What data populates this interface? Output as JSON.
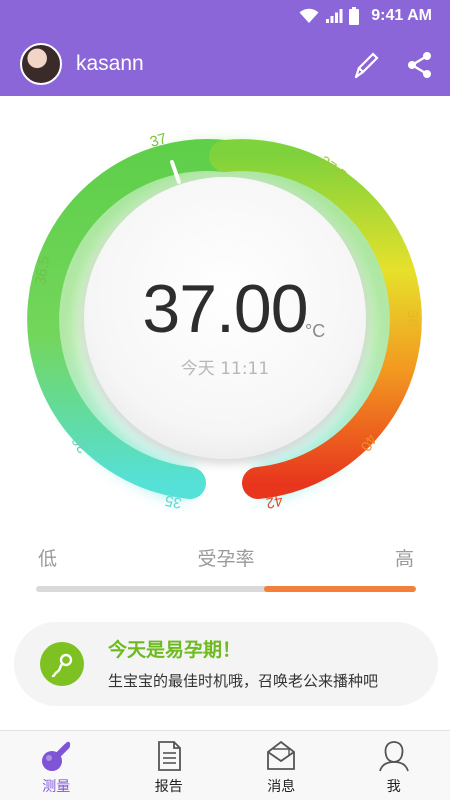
{
  "status_bar": {
    "time": "9:41 AM",
    "icons": [
      "wifi-icon",
      "signal-icon",
      "battery-icon"
    ]
  },
  "header": {
    "username": "kasann",
    "icons": [
      "avatar",
      "thermometer-icon",
      "share-icon"
    ]
  },
  "gauge": {
    "value": "37.00",
    "unit": "°C",
    "date": "今天 11:11",
    "ticks": [
      "35",
      "36",
      "36.5",
      "37",
      "37.5",
      "38",
      "40",
      "42"
    ]
  },
  "fertility": {
    "low": "低",
    "title": "受孕率",
    "high": "高",
    "level": 0.4
  },
  "tip": {
    "title": "今天是易孕期！",
    "text": "生宝宝的最佳时机哦，召唤老公来播种吧",
    "icon": "sperm-icon"
  },
  "nav": {
    "items": [
      {
        "label": "测量",
        "icon": "thermometer-icon",
        "active": true
      },
      {
        "label": "报告",
        "icon": "report-icon",
        "active": false
      },
      {
        "label": "消息",
        "icon": "message-icon",
        "active": false
      },
      {
        "label": "我",
        "icon": "user-icon",
        "active": false
      }
    ]
  },
  "colors": {
    "primary": "#8b66d8",
    "accent_green": "#7dc122",
    "bar_fill": "#f47f3b"
  }
}
